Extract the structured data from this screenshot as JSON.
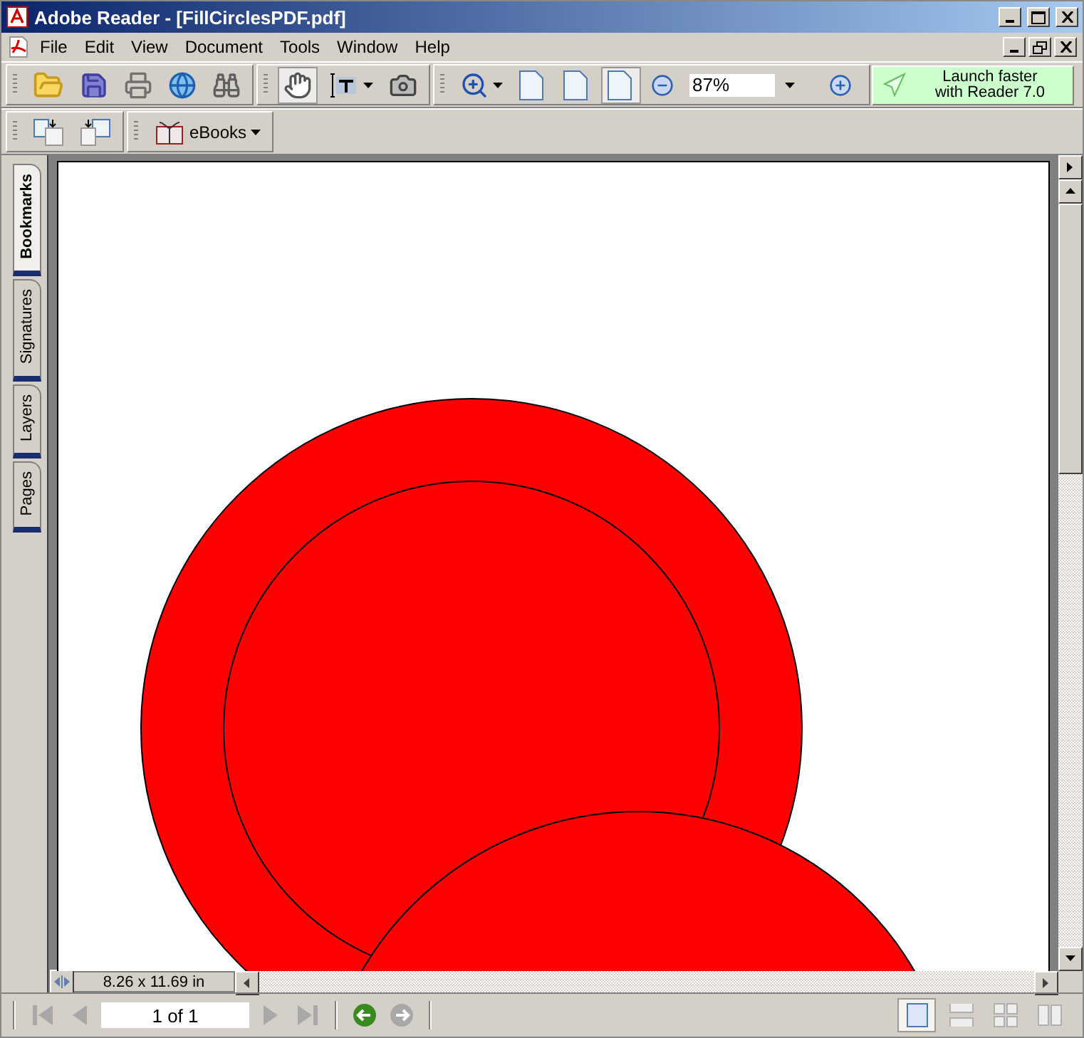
{
  "window": {
    "title": "Adobe Reader - [FillCirclesPDF.pdf]"
  },
  "menu": [
    "File",
    "Edit",
    "View",
    "Document",
    "Tools",
    "Window",
    "Help"
  ],
  "toolbar": {
    "groups": [
      [
        {
          "kind": "open",
          "selected": false,
          "menu": false
        },
        {
          "kind": "save",
          "selected": false,
          "menu": false
        },
        {
          "kind": "print",
          "selected": false,
          "menu": false
        },
        {
          "kind": "email",
          "selected": false,
          "menu": false
        },
        {
          "kind": "search",
          "selected": false,
          "menu": false
        }
      ],
      [
        {
          "kind": "hand",
          "selected": true,
          "menu": false
        },
        {
          "kind": "select-text",
          "selected": false,
          "menu": true
        },
        {
          "kind": "snapshot",
          "selected": false,
          "menu": false
        }
      ],
      [
        {
          "kind": "zoom-in",
          "selected": false,
          "menu": true
        },
        {
          "kind": "actual-size",
          "selected": false,
          "menu": false
        },
        {
          "kind": "fit-page",
          "selected": false,
          "menu": false
        },
        {
          "kind": "fit-width",
          "selected": true,
          "menu": false
        },
        {
          "kind": "zoom-out-circle",
          "selected": false,
          "menu": false
        },
        {
          "kind": "zoom-field",
          "value": "87%",
          "selected": false,
          "menu": true
        },
        {
          "kind": "zoom-in-circle",
          "selected": false,
          "menu": false
        }
      ]
    ],
    "launch_button": {
      "lines": [
        "Launch faster",
        "with Reader 7.0"
      ]
    }
  },
  "toolbar2": {
    "groups": [
      [
        {
          "kind": "rotate-cw",
          "selected": false,
          "menu": false
        },
        {
          "kind": "rotate-ccw",
          "selected": false,
          "menu": false
        }
      ],
      [
        {
          "kind": "ebooks",
          "label": "eBooks",
          "selected": false,
          "menu": true
        }
      ]
    ]
  },
  "side_tabs": [
    {
      "label": "Bookmarks",
      "selected": true
    },
    {
      "label": "Signatures",
      "selected": false
    },
    {
      "label": "Layers",
      "selected": false
    },
    {
      "label": "Pages",
      "selected": false
    }
  ],
  "status": {
    "page_size": "8.26 x 11.69 in"
  },
  "navigation": {
    "page": "1 of 1",
    "buttons": [
      {
        "kind": "first",
        "disabled": true
      },
      {
        "kind": "previous",
        "disabled": true
      },
      {
        "kind": "page-field"
      },
      {
        "kind": "next",
        "disabled": true
      },
      {
        "kind": "last",
        "disabled": true
      },
      {
        "kind": "back",
        "disabled": false
      },
      {
        "kind": "forward",
        "disabled": true
      }
    ]
  },
  "view_modes": [
    {
      "kind": "single",
      "selected": true
    },
    {
      "kind": "continuous",
      "selected": false
    },
    {
      "kind": "continuous-facing",
      "selected": false
    },
    {
      "kind": "facing",
      "selected": false
    }
  ]
}
